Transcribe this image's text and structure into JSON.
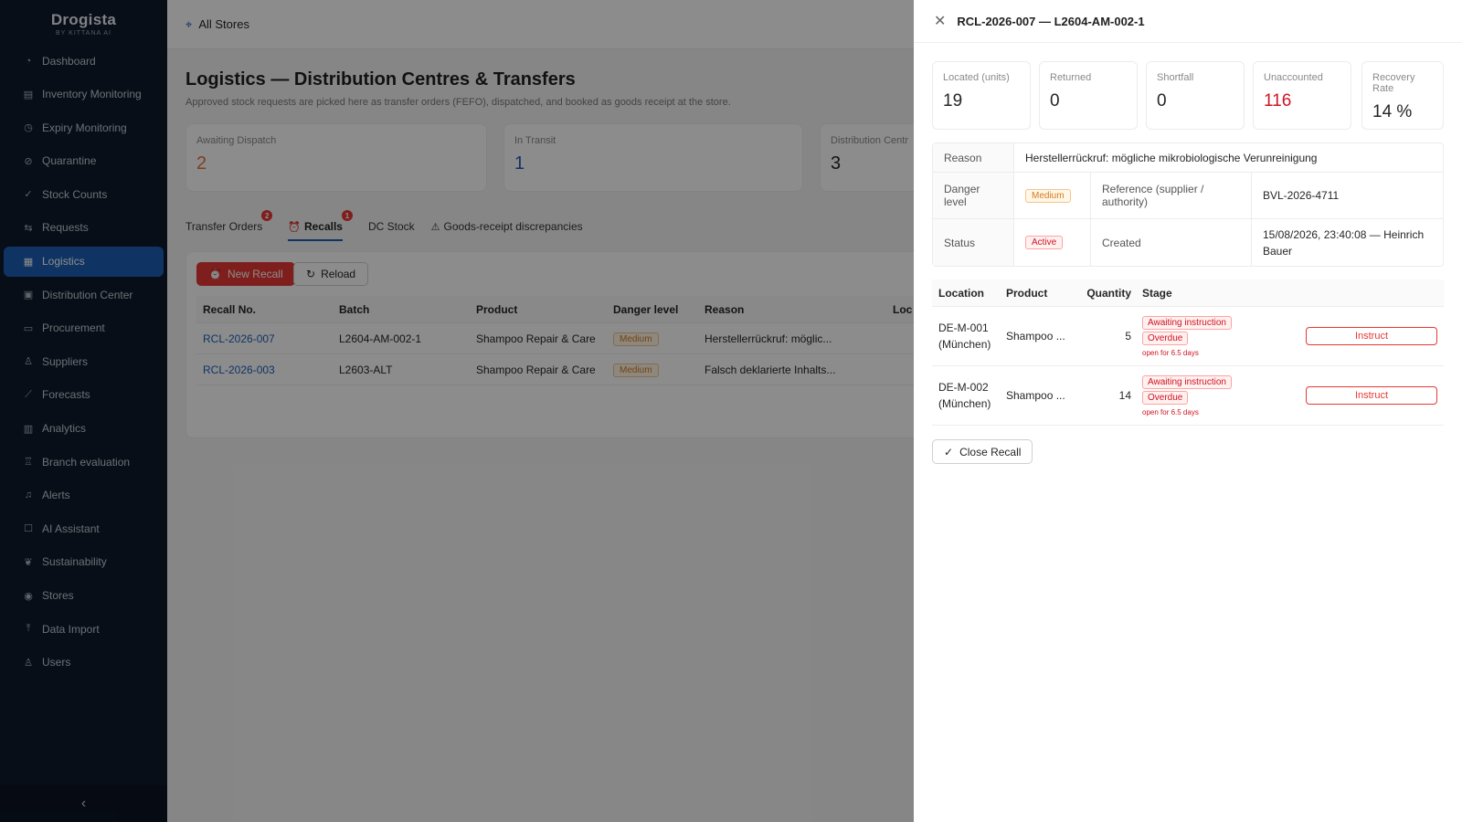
{
  "brand": {
    "name": "Drogista",
    "sub": "BY KITTANA AI"
  },
  "sidebar": {
    "items": [
      {
        "label": "Dashboard",
        "icon": "dashboard-icon"
      },
      {
        "label": "Inventory Monitoring",
        "icon": "inventory-icon"
      },
      {
        "label": "Expiry Monitoring",
        "icon": "clock-icon"
      },
      {
        "label": "Quarantine",
        "icon": "ban-icon"
      },
      {
        "label": "Stock Counts",
        "icon": "check-circle-icon"
      },
      {
        "label": "Requests",
        "icon": "requests-icon"
      },
      {
        "label": "Logistics",
        "icon": "shop-icon",
        "active": true
      },
      {
        "label": "Distribution Center",
        "icon": "container-icon"
      },
      {
        "label": "Procurement",
        "icon": "cart-icon"
      },
      {
        "label": "Suppliers",
        "icon": "team-icon"
      },
      {
        "label": "Forecasts",
        "icon": "line-chart-icon"
      },
      {
        "label": "Analytics",
        "icon": "bar-chart-icon"
      },
      {
        "label": "Branch evaluation",
        "icon": "trophy-icon"
      },
      {
        "label": "Alerts",
        "icon": "bell-icon"
      },
      {
        "label": "AI Assistant",
        "icon": "robot-icon"
      },
      {
        "label": "Sustainability",
        "icon": "leaf-icon"
      },
      {
        "label": "Stores",
        "icon": "location-icon"
      },
      {
        "label": "Data Import",
        "icon": "upload-icon"
      },
      {
        "label": "Users",
        "icon": "user-icon"
      }
    ],
    "collapse": "‹"
  },
  "topbar": {
    "store": "All Stores"
  },
  "page": {
    "title": "Logistics — Distribution Centres & Transfers",
    "subtitle": "Approved stock requests are picked here as transfer orders (FEFO), dispatched, and booked as goods receipt at the store.",
    "stats": [
      {
        "label": "Awaiting Dispatch",
        "value": "2",
        "color": "#e8743b"
      },
      {
        "label": "In Transit",
        "value": "1",
        "color": "#1c5fb6"
      },
      {
        "label": "Distribution Centr",
        "value": "3",
        "color": "#262626"
      }
    ],
    "tabs": [
      {
        "label": "Transfer Orders",
        "badge": "2"
      },
      {
        "label": "Recalls",
        "badge": "1",
        "active": true
      },
      {
        "label": "DC Stock"
      },
      {
        "label": "Goods-receipt discrepancies"
      }
    ]
  },
  "recalls": {
    "new_label": "New Recall",
    "reload_label": "Reload",
    "columns": [
      "Recall No.",
      "Batch",
      "Product",
      "Danger level",
      "Reason",
      "Loc"
    ],
    "rows": [
      {
        "no": "RCL-2026-007",
        "batch": "L2604-AM-002-1",
        "product": "Shampoo Repair & Care",
        "danger": "Medium",
        "reason": "Herstellerrückruf: möglic..."
      },
      {
        "no": "RCL-2026-003",
        "batch": "L2603-ALT",
        "product": "Shampoo Repair & Care",
        "danger": "Medium",
        "reason": "Falsch deklarierte Inhalts..."
      }
    ]
  },
  "drawer": {
    "title": "RCL-2026-007 — L2604-AM-002-1",
    "kpis": [
      {
        "label": "Located (units)",
        "value": "19"
      },
      {
        "label": "Returned",
        "value": "0"
      },
      {
        "label": "Shortfall",
        "value": "0"
      },
      {
        "label": "Unaccounted",
        "value": "116",
        "color": "#cf1322"
      },
      {
        "label": "Recovery Rate",
        "value": "14 %"
      }
    ],
    "details": {
      "reason_label": "Reason",
      "reason_value": "Herstellerrückruf: mögliche mikrobiologische Verunreinigung",
      "danger_label": "Danger level",
      "danger_value": "Medium",
      "reference_label": "Reference (supplier / authority)",
      "reference_value": "BVL-2026-4711",
      "status_label": "Status",
      "status_value": "Active",
      "created_label": "Created",
      "created_value": "15/08/2026, 23:40:08 — Heinrich Bauer"
    },
    "locations": {
      "columns": [
        "Location",
        "Product",
        "Quantity",
        "Stage",
        ""
      ],
      "rows": [
        {
          "location": "DE-M-001 (München)",
          "product": "Shampoo ...",
          "quantity": "5",
          "stage1": "Awaiting instruction",
          "stage2": "Overdue",
          "open_for": "open for 6.5 days",
          "action": "Instruct"
        },
        {
          "location": "DE-M-002 (München)",
          "product": "Shampoo ...",
          "quantity": "14",
          "stage1": "Awaiting instruction",
          "stage2": "Overdue",
          "open_for": "open for 6.5 days",
          "action": "Instruct"
        }
      ]
    },
    "close_recall_label": "Close Recall"
  }
}
